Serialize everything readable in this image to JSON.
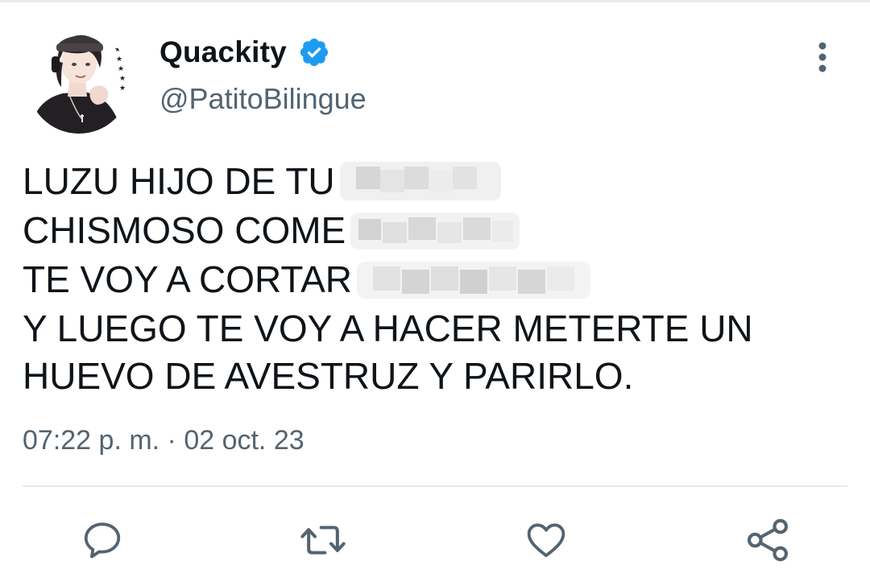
{
  "tweet": {
    "author": {
      "display_name": "Quackity",
      "handle": "@PatitoBilingue",
      "verified": true
    },
    "text_lines": [
      "LUZU HIJO DE TU",
      "CHISMOSO COME",
      "TE VOY A CORTAR",
      "Y LUEGO TE VOY A HACER METERTE UN",
      "HUEVO DE AVESTRUZ Y PARIRLO."
    ],
    "timestamp": "07:22 p. m. · 02 oct. 23"
  },
  "actions": {
    "reply_icon": "reply-icon",
    "retweet_icon": "retweet-icon",
    "like_icon": "heart-icon",
    "share_icon": "share-icon",
    "more_icon": "more-vertical-icon"
  },
  "colors": {
    "text": "#0f1419",
    "secondary": "#536471",
    "verified": "#1d9bf0",
    "divider": "#e6e9eb"
  }
}
